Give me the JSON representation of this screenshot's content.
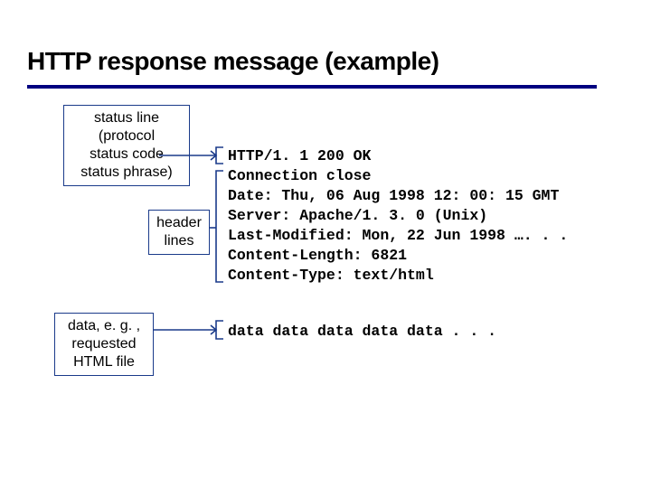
{
  "title": "HTTP response message (example)",
  "labels": {
    "status": "status line\n(protocol\nstatus code\nstatus phrase)",
    "header": "header\nlines",
    "data": "data, e. g. ,\nrequested\nHTML file"
  },
  "message": {
    "status_line": "HTTP/1. 1 200 OK",
    "headers": [
      "Connection close",
      "Date: Thu, 06 Aug 1998 12: 00: 15 GMT",
      "Server: Apache/1. 3. 0 (Unix)",
      "Last-Modified: Mon, 22 Jun 1998 …. . .",
      "Content-Length: 6821",
      "Content-Type: text/html"
    ],
    "body": "data data data data data . . ."
  }
}
